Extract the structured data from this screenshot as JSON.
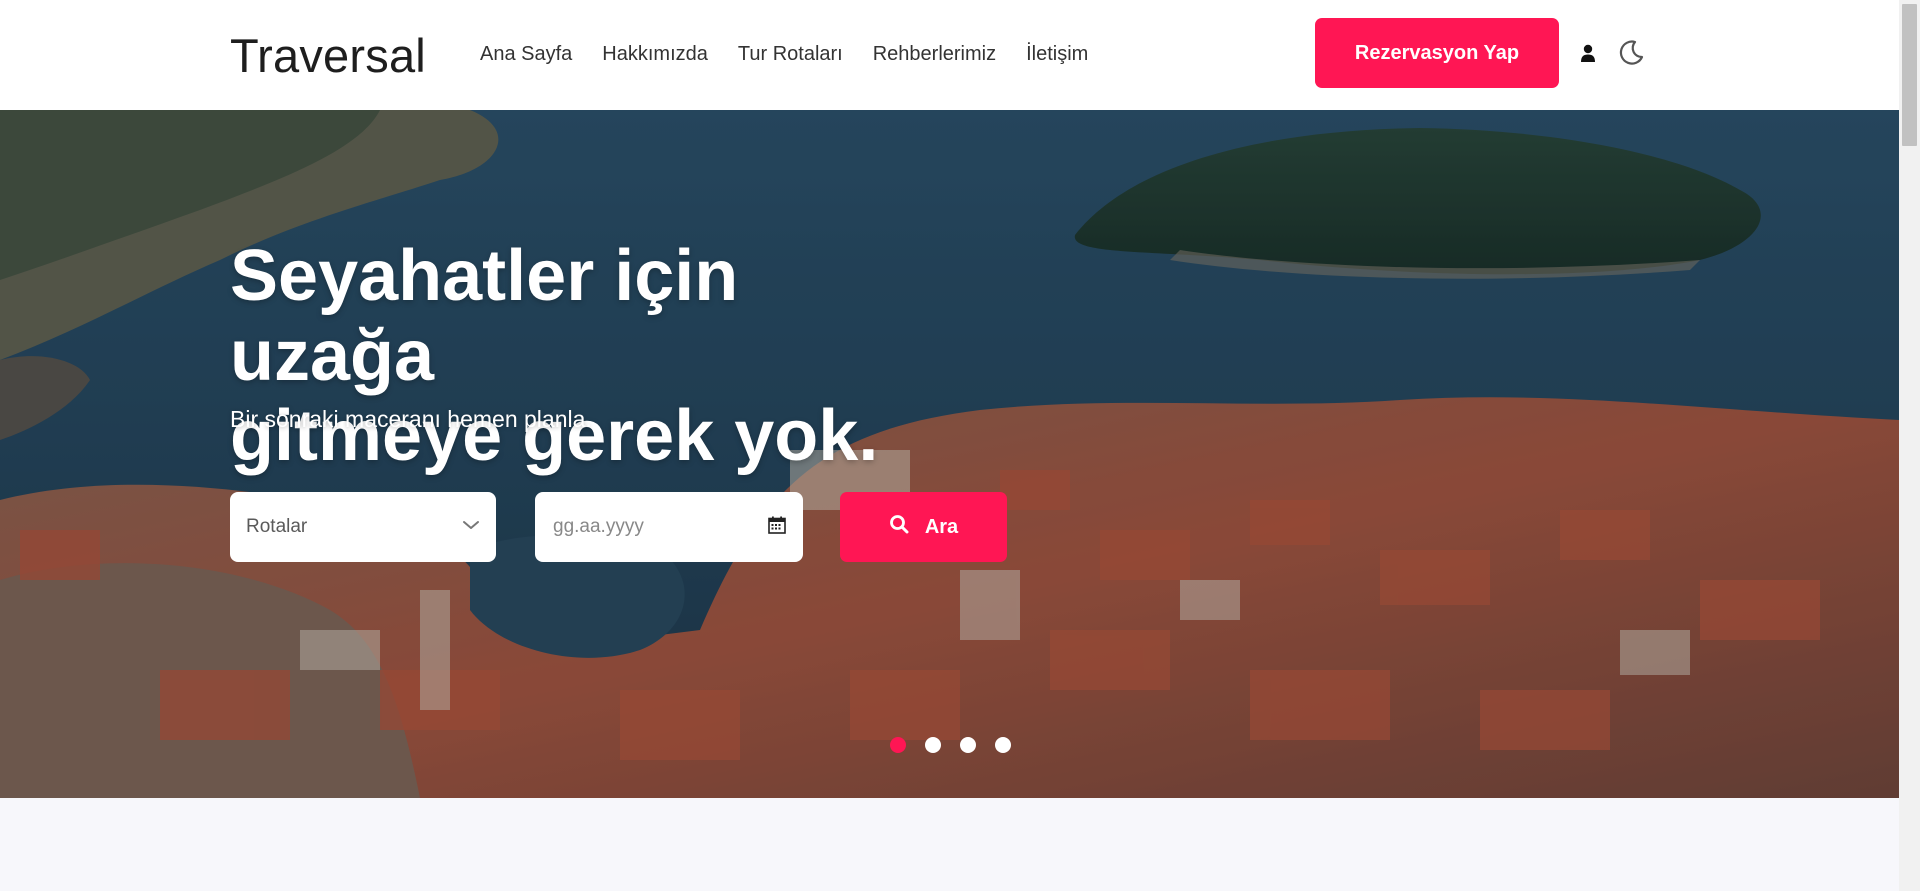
{
  "brand": {
    "name": "Traversal"
  },
  "nav": {
    "links": [
      {
        "label": "Ana Sayfa"
      },
      {
        "label": "Hakkımızda"
      },
      {
        "label": "Tur Rotaları"
      },
      {
        "label": "Rehberlerimiz"
      },
      {
        "label": "İletişim"
      }
    ],
    "reserve_label": "Rezervasyon Yap"
  },
  "hero": {
    "title_line1": "Seyahatler için uzağa",
    "title_line2": "gitmeye gerek yok.",
    "subtitle": "Bir sonraki maceranı hemen planla.",
    "search": {
      "route_select_value": "Rotalar",
      "date_placeholder": "gg.aa.yyyy",
      "button_label": "Ara"
    },
    "carousel": {
      "slide_count": 4,
      "active_index": 0
    }
  },
  "colors": {
    "accent": "#ff1654",
    "navbar_bg": "#ffffff",
    "page_bg": "#f7f7fb"
  },
  "icons": {
    "user": "user-icon",
    "theme": "moon-icon",
    "select": "chevron-down-icon",
    "date": "calendar-icon",
    "search": "search-icon"
  }
}
